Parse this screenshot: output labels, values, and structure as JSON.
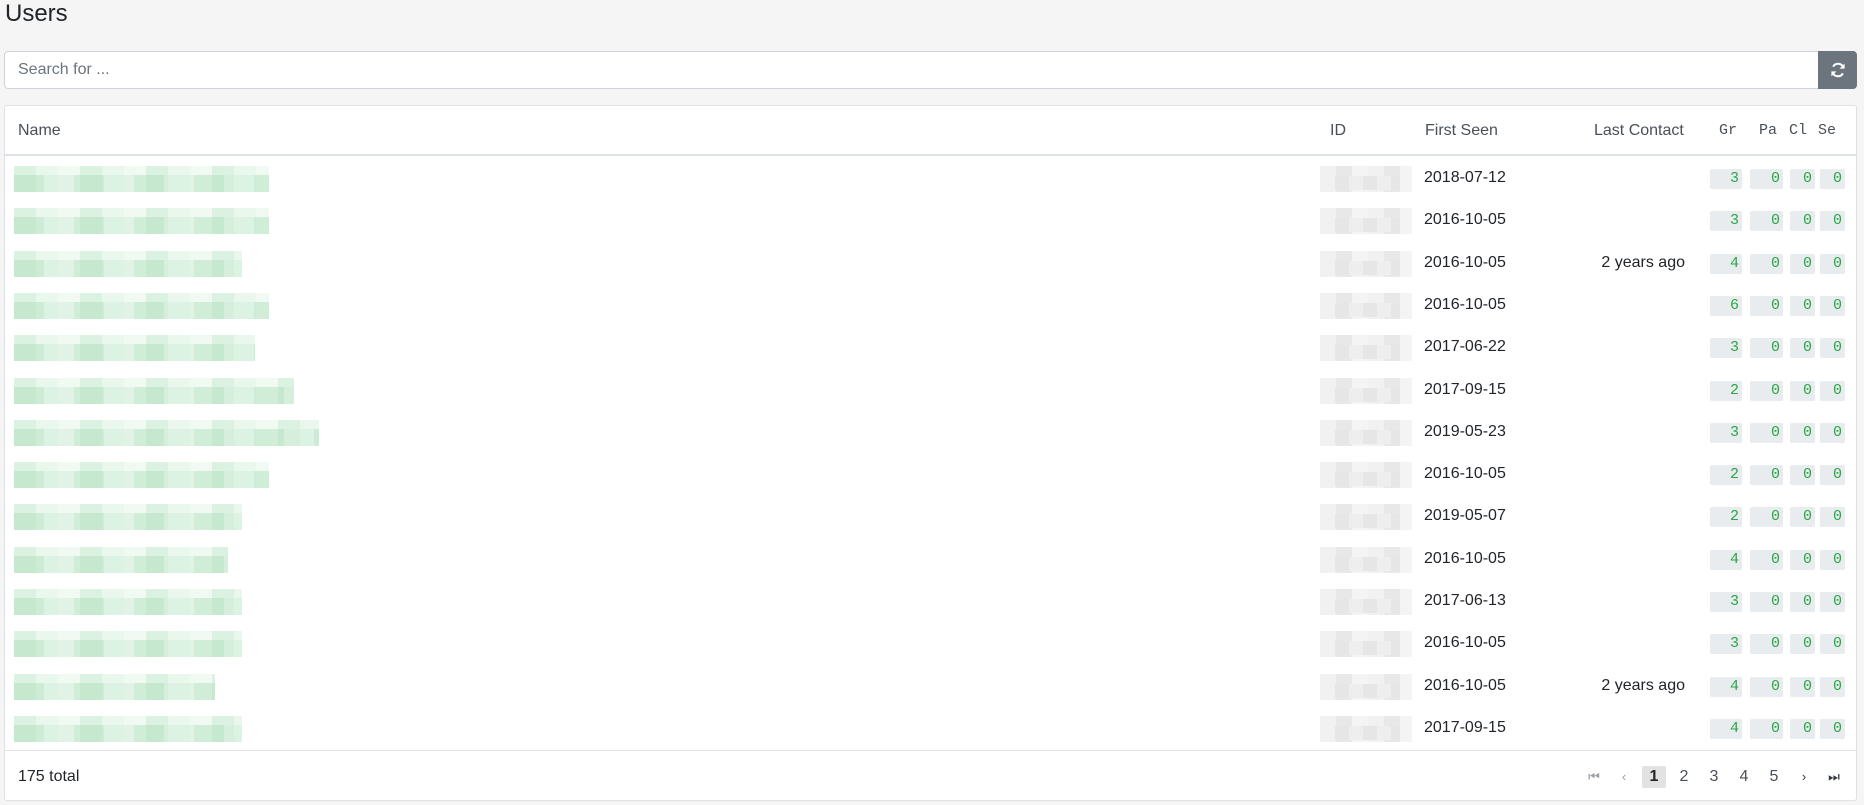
{
  "page": {
    "title": "Users"
  },
  "search": {
    "placeholder": "Search for ...",
    "value": ""
  },
  "refresh_icon": "refresh-icon",
  "table": {
    "headers": {
      "name": "Name",
      "id": "ID",
      "first_seen": "First Seen",
      "last_contact": "Last Contact",
      "gr": "Gr",
      "pa": "Pa",
      "cl": "Cl",
      "se": "Se"
    },
    "rows": [
      {
        "first_seen": "2018-07-12",
        "last_contact": "",
        "gr": "3",
        "pa": "0",
        "cl": "0",
        "se": "0"
      },
      {
        "first_seen": "2016-10-05",
        "last_contact": "",
        "gr": "3",
        "pa": "0",
        "cl": "0",
        "se": "0"
      },
      {
        "first_seen": "2016-10-05",
        "last_contact": "2 years ago",
        "gr": "4",
        "pa": "0",
        "cl": "0",
        "se": "0"
      },
      {
        "first_seen": "2016-10-05",
        "last_contact": "",
        "gr": "6",
        "pa": "0",
        "cl": "0",
        "se": "0"
      },
      {
        "first_seen": "2017-06-22",
        "last_contact": "",
        "gr": "3",
        "pa": "0",
        "cl": "0",
        "se": "0"
      },
      {
        "first_seen": "2017-09-15",
        "last_contact": "",
        "gr": "2",
        "pa": "0",
        "cl": "0",
        "se": "0"
      },
      {
        "first_seen": "2019-05-23",
        "last_contact": "",
        "gr": "3",
        "pa": "0",
        "cl": "0",
        "se": "0"
      },
      {
        "first_seen": "2016-10-05",
        "last_contact": "",
        "gr": "2",
        "pa": "0",
        "cl": "0",
        "se": "0"
      },
      {
        "first_seen": "2019-05-07",
        "last_contact": "",
        "gr": "2",
        "pa": "0",
        "cl": "0",
        "se": "0"
      },
      {
        "first_seen": "2016-10-05",
        "last_contact": "",
        "gr": "4",
        "pa": "0",
        "cl": "0",
        "se": "0"
      },
      {
        "first_seen": "2017-06-13",
        "last_contact": "",
        "gr": "3",
        "pa": "0",
        "cl": "0",
        "se": "0"
      },
      {
        "first_seen": "2016-10-05",
        "last_contact": "",
        "gr": "3",
        "pa": "0",
        "cl": "0",
        "se": "0"
      },
      {
        "first_seen": "2016-10-05",
        "last_contact": "2 years ago",
        "gr": "4",
        "pa": "0",
        "cl": "0",
        "se": "0"
      },
      {
        "first_seen": "2017-09-15",
        "last_contact": "",
        "gr": "4",
        "pa": "0",
        "cl": "0",
        "se": "0"
      }
    ]
  },
  "footer": {
    "total": "175 total",
    "pages": [
      "1",
      "2",
      "3",
      "4",
      "5"
    ],
    "current_page": "1",
    "nav_icons": {
      "first": "first-page-icon",
      "prev": "prev-page-icon",
      "next": "next-page-icon",
      "last": "last-page-icon"
    }
  },
  "colors": {
    "badge_text": "#28a745",
    "badge_bg": "#e9ecef",
    "refresh_button": "#6c757d"
  }
}
